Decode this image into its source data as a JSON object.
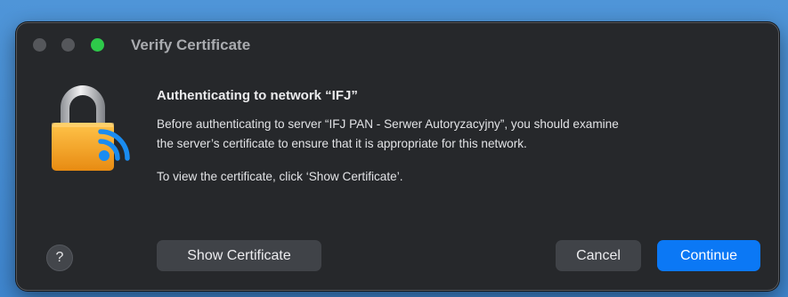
{
  "window": {
    "title": "Verify Certificate",
    "traffic_lights": [
      "close",
      "minimize",
      "zoom"
    ]
  },
  "dialog": {
    "icon": "lock-wifi-icon",
    "heading": "Authenticating to network “IFJ”",
    "message": "Before authenticating to server “IFJ PAN - Serwer Autoryzacyjny”, you should examine\nthe server’s certificate to ensure that it is appropriate for this network.",
    "instruction": "To view the certificate, click ‘Show Certificate’."
  },
  "buttons": {
    "help": "?",
    "show_certificate": "Show Certificate",
    "cancel": "Cancel",
    "continue": "Continue"
  },
  "colors": {
    "background": "#3f86cf",
    "window": "#26282b",
    "accent": "#0b78f5",
    "lock_body": "#f6a623",
    "wifi": "#1a8cf0",
    "zoom_light": "#2ec94a"
  }
}
